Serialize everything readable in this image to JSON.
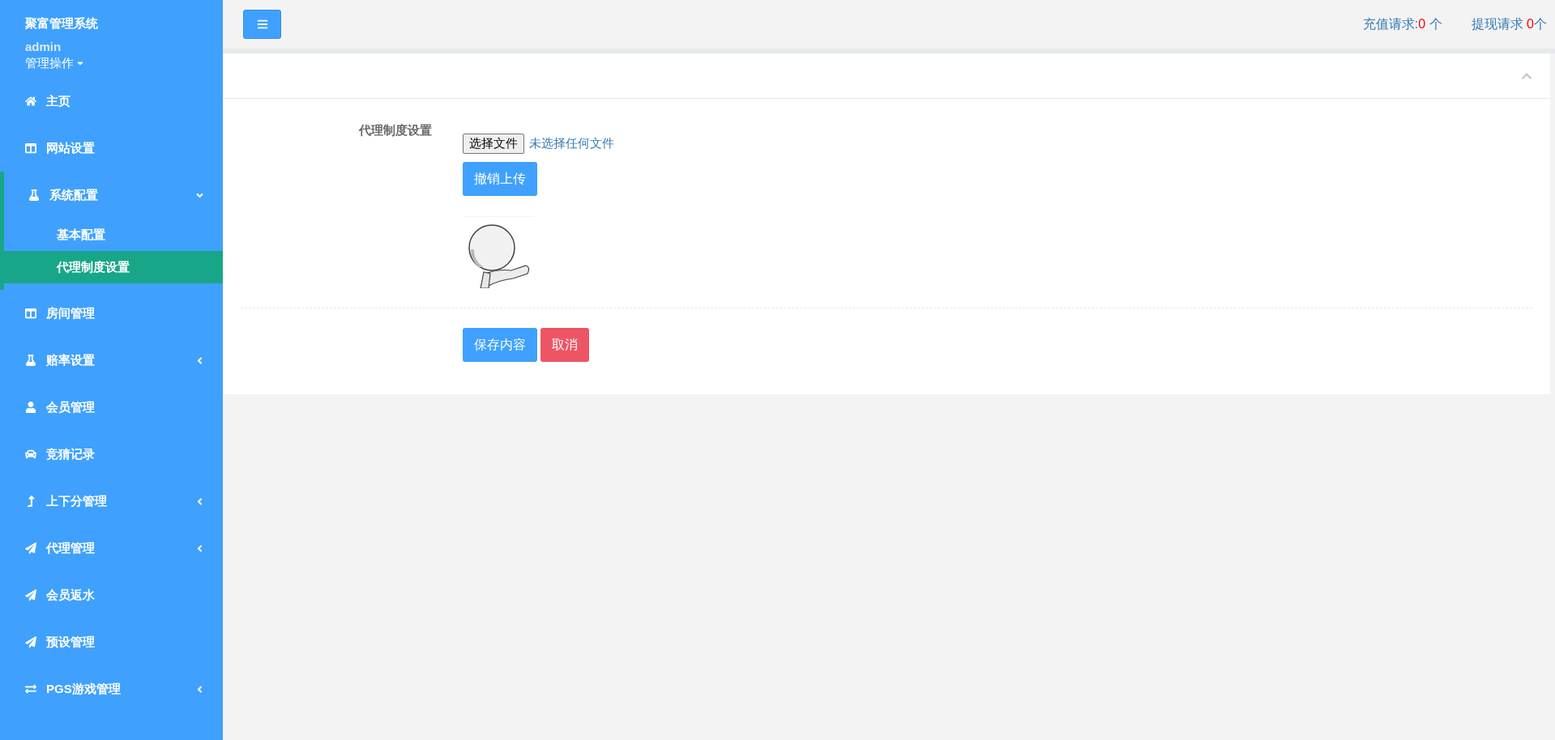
{
  "sidebar": {
    "title": "聚富管理系统",
    "user": "admin",
    "user_menu": "管理操作",
    "items": [
      {
        "label": "主页",
        "kind": "home"
      },
      {
        "label": "网站设置",
        "kind": "columns"
      },
      {
        "label": "系统配置",
        "kind": "flask",
        "expanded": true,
        "children": [
          {
            "label": "基本配置",
            "selected": false
          },
          {
            "label": "代理制度设置",
            "selected": true
          }
        ]
      },
      {
        "label": "房间管理",
        "kind": "columns"
      },
      {
        "label": "赔率设置",
        "kind": "flask",
        "expanded": false
      },
      {
        "label": "会员管理",
        "kind": "user"
      },
      {
        "label": "竞猜记录",
        "kind": "car"
      },
      {
        "label": "上下分管理",
        "kind": "levelup",
        "expanded": false
      },
      {
        "label": "代理管理",
        "kind": "send",
        "expanded": false
      },
      {
        "label": "会员返水",
        "kind": "send"
      },
      {
        "label": "预设管理",
        "kind": "send"
      },
      {
        "label": "PGS游戏管理",
        "kind": "exchange",
        "expanded": false
      }
    ]
  },
  "topbar": {
    "requests": [
      {
        "label": "充值请求:",
        "count": "0",
        "unit": " 个"
      },
      {
        "label": "提现请求 ",
        "count": "0",
        "unit": "个"
      }
    ]
  },
  "form": {
    "label": "代理制度设置",
    "file_button": "选择文件",
    "file_status": "未选择任何文件",
    "undo_button": "撤销上传",
    "actions": [
      {
        "label": "保存内容",
        "kind": "primary"
      },
      {
        "label": "取消",
        "kind": "danger"
      }
    ]
  }
}
